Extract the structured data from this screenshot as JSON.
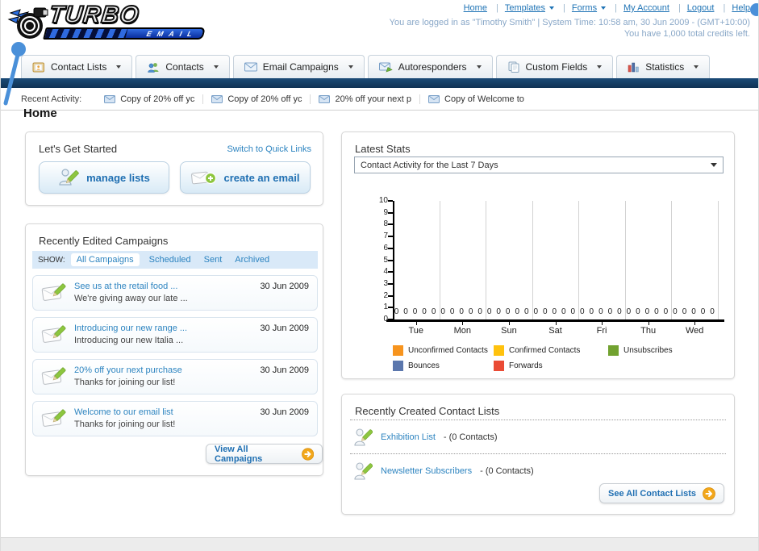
{
  "logo": {
    "title": "TURBO",
    "subtitle": "EMAIL"
  },
  "header": {
    "nav": [
      {
        "label": "Home"
      },
      {
        "label": "Templates",
        "has_dropdown": true
      },
      {
        "label": "Forms",
        "has_dropdown": true
      },
      {
        "label": "My Account"
      },
      {
        "label": "Logout"
      },
      {
        "label": "Help"
      }
    ],
    "login_info": "You are logged in as \"Timothy Smith\" | System Time: 10:58 am, 30 Jun 2009 - (GMT+10:00)",
    "credits_info": "You have 1,000 total credits left."
  },
  "tabs": [
    {
      "label": "Contact Lists"
    },
    {
      "label": "Contacts"
    },
    {
      "label": "Email Campaigns"
    },
    {
      "label": "Autoresponders"
    },
    {
      "label": "Custom Fields"
    },
    {
      "label": "Statistics"
    }
  ],
  "recent_activity": {
    "label": "Recent Activity:",
    "items": [
      {
        "text": "Copy of 20% off yc"
      },
      {
        "text": "Copy of 20% off yc"
      },
      {
        "text": "20% off your next p"
      },
      {
        "text": "Copy of Welcome to"
      }
    ]
  },
  "home_title": "Home",
  "get_started": {
    "title": "Let's Get Started",
    "switch_link": "Switch to Quick Links",
    "manage_lists_label": "manage lists",
    "create_email_label": "create an email"
  },
  "campaigns": {
    "title": "Recently Edited Campaigns",
    "show_label": "SHOW:",
    "filters": [
      {
        "label": "All Campaigns",
        "active": true
      },
      {
        "label": "Scheduled"
      },
      {
        "label": "Sent"
      },
      {
        "label": "Archived"
      }
    ],
    "items": [
      {
        "title": "See us at the retail food ...",
        "subtitle": "We're giving away our late ...",
        "date": "30 Jun 2009"
      },
      {
        "title": "Introducing our new range ...",
        "subtitle": "Introducing our new Italia ...",
        "date": "30 Jun 2009"
      },
      {
        "title": "20% off your next purchase",
        "subtitle": "Thanks for joining our list!",
        "date": "30 Jun 2009"
      },
      {
        "title": "Welcome to our email list",
        "subtitle": "Thanks for joining our list!",
        "date": "30 Jun 2009"
      }
    ],
    "view_all_label": "View All Campaigns"
  },
  "stats": {
    "title": "Latest Stats",
    "dropdown_value": "Contact Activity for the Last 7 Days"
  },
  "chart_data": {
    "type": "bar",
    "title": "Contact Activity for the Last 7 Days",
    "categories": [
      "Tue",
      "Mon",
      "Sun",
      "Sat",
      "Fri",
      "Thu",
      "Wed"
    ],
    "series": [
      {
        "name": "Unconfirmed Contacts",
        "color": "#f7941e",
        "values": [
          0,
          0,
          0,
          0,
          0,
          0,
          0
        ]
      },
      {
        "name": "Confirmed Contacts",
        "color": "#ffc20e",
        "values": [
          0,
          0,
          0,
          0,
          0,
          0,
          0
        ]
      },
      {
        "name": "Unsubscribes",
        "color": "#72a230",
        "values": [
          0,
          0,
          0,
          0,
          0,
          0,
          0
        ]
      },
      {
        "name": "Bounces",
        "color": "#5b77ad",
        "values": [
          0,
          0,
          0,
          0,
          0,
          0,
          0
        ]
      },
      {
        "name": "Forwards",
        "color": "#ea4b35",
        "values": [
          0,
          0,
          0,
          0,
          0,
          0,
          0
        ]
      }
    ],
    "xlabel": "",
    "ylabel": "",
    "ylim": [
      0,
      10
    ],
    "yticks": [
      0,
      1,
      2,
      3,
      4,
      5,
      6,
      7,
      8,
      9,
      10
    ],
    "grid": "vertical",
    "legend_position": "bottom"
  },
  "contact_lists": {
    "title": "Recently Created Contact Lists",
    "items": [
      {
        "name": "Exhibition List",
        "detail": "- (0 Contacts)"
      },
      {
        "name": "Newsletter Subscribers",
        "detail": "- (0 Contacts)"
      }
    ],
    "see_all_label": "See All Contact Lists"
  }
}
